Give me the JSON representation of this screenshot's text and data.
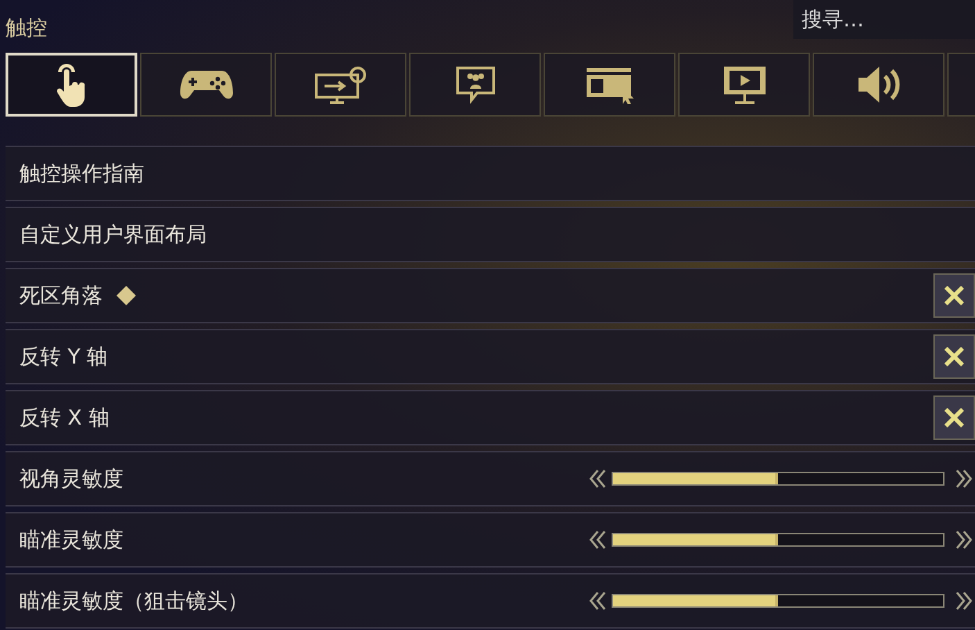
{
  "section_title": "触控",
  "search": {
    "placeholder": "搜寻…"
  },
  "tabs": [
    {
      "kind": "touch",
      "selected": true
    },
    {
      "kind": "gamepad",
      "selected": false
    },
    {
      "kind": "display",
      "selected": false
    },
    {
      "kind": "chat",
      "selected": false
    },
    {
      "kind": "layout",
      "selected": false
    },
    {
      "kind": "monitor",
      "selected": false
    },
    {
      "kind": "speaker",
      "selected": false
    },
    {
      "kind": "partial",
      "selected": false
    }
  ],
  "settings": [
    {
      "kind": "link",
      "label": "触控操作指南"
    },
    {
      "kind": "link",
      "label": "自定义用户界面布局"
    },
    {
      "kind": "toggle",
      "label": "死区角落",
      "diamond": true,
      "checked": true
    },
    {
      "kind": "toggle",
      "label": "反转 Y 轴",
      "checked": true
    },
    {
      "kind": "toggle",
      "label": "反转 X 轴",
      "checked": true
    },
    {
      "kind": "slider",
      "label": "视角灵敏度",
      "level": 0.5
    },
    {
      "kind": "slider",
      "label": "瞄准灵敏度",
      "level": 0.5
    },
    {
      "kind": "slider",
      "label": "瞄准灵敏度（狙击镜头）",
      "level": 0.5
    }
  ]
}
